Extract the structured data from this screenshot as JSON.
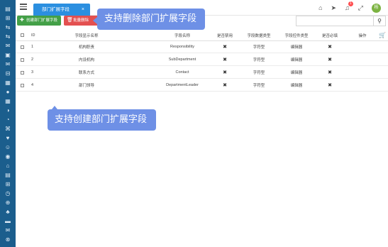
{
  "sidebar": {
    "icons": [
      "▤",
      "⊞",
      "⇆",
      "⇆",
      "✉",
      "▣",
      "✉",
      "⊟",
      "▦",
      "●",
      "▦",
      "◑",
      "◔",
      "⌘",
      "♥",
      "☺",
      "◉",
      "⌂",
      "▤",
      "⊞",
      "◷",
      "⊕",
      "♣",
      "▬",
      "✉",
      "⊗"
    ]
  },
  "tab": {
    "label": "部门扩展字段",
    "close": "×"
  },
  "top_icons": {
    "home": "⌂",
    "send": "➤",
    "bell": "♫",
    "bell_count": "1",
    "expand": "⤢",
    "avatar_text": "杨"
  },
  "toolbar": {
    "add_label": "创建部门扩展字段",
    "add_icon": "✚",
    "delete_label": "批量删除",
    "delete_icon": "🗑"
  },
  "search": {
    "placeholder": "",
    "icon": "⚲"
  },
  "table": {
    "headers": {
      "id": "ID",
      "display_name": "字段显示名称",
      "field_name": "字段名称",
      "disabled": "是否禁用",
      "data_type": "字段数据类型",
      "control_type": "字段控件类型",
      "required": "是否必填",
      "operation": "操作",
      "cart_icon": "🛒"
    },
    "rows": [
      {
        "id": "1",
        "display_name": "机构职责",
        "field_name": "Responsibility",
        "disabled": "✖",
        "data_type": "字符型",
        "control_type": "编辑器",
        "required": "✖"
      },
      {
        "id": "2",
        "display_name": "内设机构",
        "field_name": "SubDepartment",
        "disabled": "✖",
        "data_type": "字符型",
        "control_type": "编辑器",
        "required": "✖"
      },
      {
        "id": "3",
        "display_name": "联系方式",
        "field_name": "Contact",
        "disabled": "✖",
        "data_type": "字符型",
        "control_type": "编辑器",
        "required": "✖"
      },
      {
        "id": "4",
        "display_name": "部门领导",
        "field_name": "DepartmentLeader",
        "disabled": "✖",
        "data_type": "字符型",
        "control_type": "编辑器",
        "required": "✖"
      }
    ]
  },
  "callouts": {
    "delete": "支持删除部门扩展字段",
    "create": "支持创建部门扩展字段"
  }
}
